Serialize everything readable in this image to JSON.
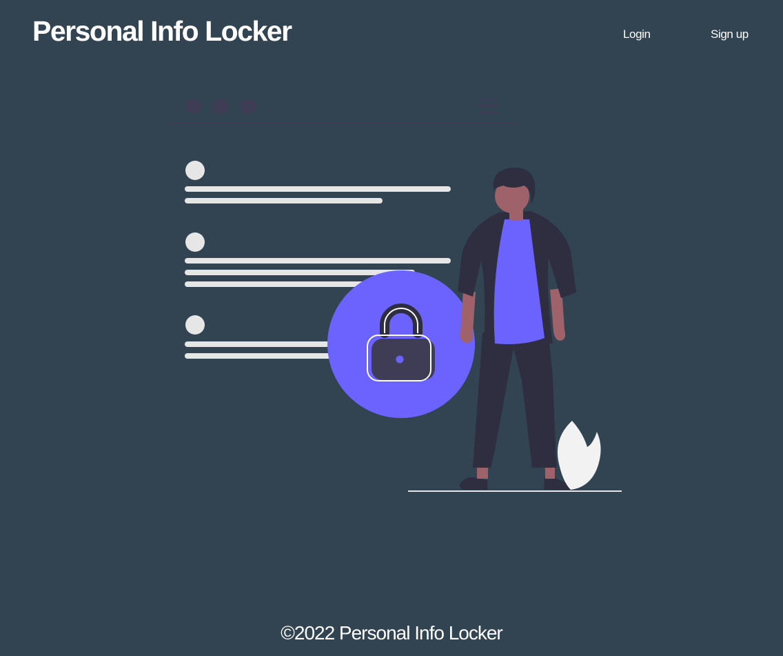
{
  "header": {
    "brand": "Personal Info Locker",
    "nav": {
      "login_label": "Login",
      "signup_label": "Sign up"
    }
  },
  "hero": {
    "illustration": "security-lock-person-illustration",
    "colors": {
      "accent": "#6c63ff",
      "dark": "#2f2e41",
      "skin": "#9f616a",
      "light": "#e6e6e6",
      "background": "#324452"
    }
  },
  "footer": {
    "copyright": "©2022 Personal Info Locker"
  }
}
